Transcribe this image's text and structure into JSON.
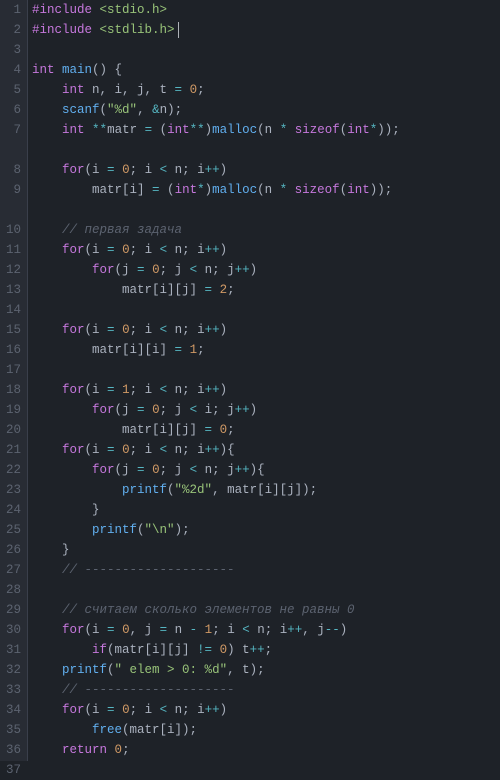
{
  "gutter": {
    "lines": [
      "1",
      "2",
      "3",
      "4",
      "5",
      "6",
      "7",
      "8",
      "9",
      "10",
      "11",
      "12",
      "13",
      "14",
      "15",
      "16",
      "17",
      "18",
      "19",
      "20",
      "21",
      "22",
      "23",
      "24",
      "25",
      "26",
      "27",
      "28",
      "29",
      "30",
      "31",
      "32",
      "33",
      "34",
      "35",
      "36",
      "37"
    ],
    "wrapped": [
      7,
      9
    ]
  },
  "code": {
    "l1": {
      "pre": "#include ",
      "inc": "<stdio.h>"
    },
    "l2": {
      "pre": "#include ",
      "inc": "<stdlib.h>"
    },
    "l3": "",
    "l4": {
      "t1": "int",
      "sp": " ",
      "fn": "main",
      "p": "() {"
    },
    "l5": {
      "ind": "    ",
      "t": "int",
      "v": " n, i, j, t ",
      "op": "=",
      "sp": " ",
      "n": "0",
      "p": ";"
    },
    "l6": {
      "ind": "    ",
      "fn": "scanf",
      "p1": "(",
      "s": "\"%d\"",
      "c": ", ",
      "amp": "&",
      "v": "n",
      "p2": ");"
    },
    "l7": {
      "ind": "    ",
      "t1": "int",
      "sp": " ",
      "op1": "**",
      "v1": "matr ",
      "eq": "=",
      "sp2": " (",
      "t2": "int",
      "op2": "**",
      ")": ")",
      "fn": "malloc",
      "p1": "(n ",
      "op3": "*",
      "sp3": " ",
      "so": "sizeof",
      "p2": "(",
      "t3": "int",
      "op4": "*",
      "p3": "));"
    },
    "l8": {
      "ind": "    ",
      "kw": "for",
      "p1": "(i ",
      "eq": "=",
      "sp": " ",
      "n": "0",
      "p2": "; i ",
      "lt": "<",
      "p3": " n; i",
      "pp": "++",
      "p4": ")"
    },
    "l9": {
      "ind": "        ",
      "v": "matr[i] ",
      "eq": "=",
      "sp": " (",
      "t": "int",
      "op": "*",
      ")": ")",
      "fn": "malloc",
      "p1": "(n ",
      "mul": "*",
      "sp2": " ",
      "so": "sizeof",
      "p2": "(",
      "t2": "int",
      "p3": "));"
    },
    "l10": {
      "ind": "    ",
      "c": "// первая задача"
    },
    "l11": {
      "ind": "    ",
      "kw": "for",
      "p1": "(i ",
      "eq": "=",
      "sp": " ",
      "n": "0",
      "p2": "; i ",
      "lt": "<",
      "p3": " n; i",
      "pp": "++",
      "p4": ")"
    },
    "l12": {
      "ind": "        ",
      "kw": "for",
      "p1": "(j ",
      "eq": "=",
      "sp": " ",
      "n": "0",
      "p2": "; j ",
      "lt": "<",
      "p3": " n; j",
      "pp": "++",
      "p4": ")"
    },
    "l13": {
      "ind": "            ",
      "v": "matr[i][j] ",
      "eq": "=",
      "sp": " ",
      "n": "2",
      "p": ";"
    },
    "l14": "",
    "l15": {
      "ind": "    ",
      "kw": "for",
      "p1": "(i ",
      "eq": "=",
      "sp": " ",
      "n": "0",
      "p2": "; i ",
      "lt": "<",
      "p3": " n; i",
      "pp": "++",
      "p4": ")"
    },
    "l16": {
      "ind": "        ",
      "v": "matr[i][i] ",
      "eq": "=",
      "sp": " ",
      "n": "1",
      "p": ";"
    },
    "l17": "",
    "l18": {
      "ind": "    ",
      "kw": "for",
      "p1": "(i ",
      "eq": "=",
      "sp": " ",
      "n": "1",
      "p2": "; i ",
      "lt": "<",
      "p3": " n; i",
      "pp": "++",
      "p4": ")"
    },
    "l19": {
      "ind": "        ",
      "kw": "for",
      "p1": "(j ",
      "eq": "=",
      "sp": " ",
      "n": "0",
      "p2": "; j ",
      "lt": "<",
      "p3": " i; j",
      "pp": "++",
      "p4": ")"
    },
    "l20": {
      "ind": "            ",
      "v": "matr[i][j] ",
      "eq": "=",
      "sp": " ",
      "n": "0",
      "p": ";"
    },
    "l21": {
      "ind": "    ",
      "kw": "for",
      "p1": "(i ",
      "eq": "=",
      "sp": " ",
      "n": "0",
      "p2": "; i ",
      "lt": "<",
      "p3": " n; i",
      "pp": "++",
      "p4": "){"
    },
    "l22": {
      "ind": "        ",
      "kw": "for",
      "p1": "(j ",
      "eq": "=",
      "sp": " ",
      "n": "0",
      "p2": "; j ",
      "lt": "<",
      "p3": " n; j",
      "pp": "++",
      "p4": "){"
    },
    "l23": {
      "ind": "            ",
      "fn": "printf",
      "p1": "(",
      "s": "\"%2d\"",
      "c": ", matr[i][j]);"
    },
    "l24": {
      "ind": "        ",
      "p": "}"
    },
    "l25": {
      "ind": "        ",
      "fn": "printf",
      "p1": "(",
      "s": "\"\\n\"",
      "p2": ");"
    },
    "l26": {
      "ind": "    ",
      "p": "}"
    },
    "l27": {
      "ind": "    ",
      "c": "// --------------------"
    },
    "l28": "",
    "l29": {
      "ind": "    ",
      "c": "// считаем сколько элементов не равны 0"
    },
    "l30": {
      "ind": "    ",
      "kw": "for",
      "p1": "(i ",
      "eq": "=",
      "sp": " ",
      "n1": "0",
      "c": ", j ",
      "eq2": "=",
      "sp2": " n ",
      "mn": "-",
      "sp3": " ",
      "n2": "1",
      "p2": "; i ",
      "lt": "<",
      "p3": " n; i",
      "pp": "++",
      "c2": ", j",
      "mm": "--",
      "p4": ")"
    },
    "l31": {
      "ind": "        ",
      "kw": "if",
      "p1": "(matr[i][j] ",
      "ne": "!=",
      "sp": " ",
      "n": "0",
      "p2": ") t",
      "pp": "++",
      "p3": ";"
    },
    "l32": {
      "ind": "    ",
      "fn": "printf",
      "p1": "(",
      "s": "\" elem > 0: %d\"",
      "c": ", t);"
    },
    "l33": {
      "ind": "    ",
      "c": "// --------------------"
    },
    "l34": {
      "ind": "    ",
      "kw": "for",
      "p1": "(i ",
      "eq": "=",
      "sp": " ",
      "n": "0",
      "p2": "; i ",
      "lt": "<",
      "p3": " n; i",
      "pp": "++",
      "p4": ")"
    },
    "l35": {
      "ind": "        ",
      "fn": "free",
      "p": "(matr[i]);"
    },
    "l36": {
      "ind": "    ",
      "kw": "return",
      "sp": " ",
      "n": "0",
      "p": ";"
    },
    "l37": {
      "p": "}"
    }
  }
}
